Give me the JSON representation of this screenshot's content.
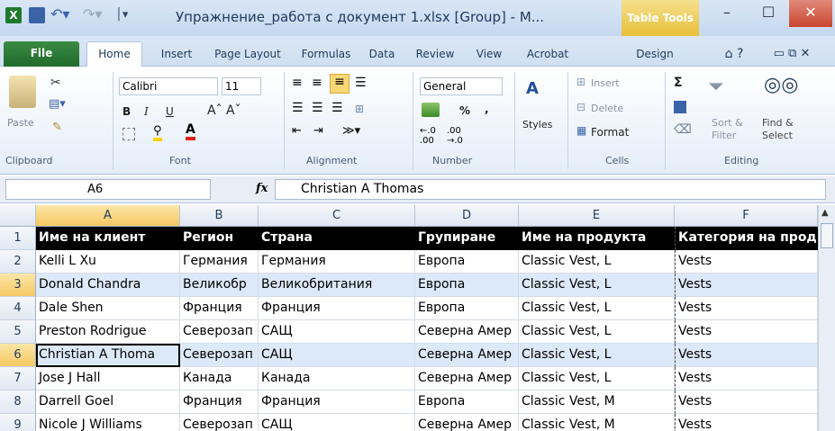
{
  "window": {
    "title": "Упражнение_работа с документ 1.xlsx  [Group]  -  M...",
    "context_tab": "Table Tools",
    "minimize": "–",
    "maximize": "☐",
    "close": "✕"
  },
  "tabs": [
    "File",
    "Home",
    "Insert",
    "Page Layout",
    "Formulas",
    "Data",
    "Review",
    "View",
    "Acrobat",
    "Design"
  ],
  "ribbon": {
    "clipboard": {
      "paste": "Paste",
      "label": "Clipboard"
    },
    "font": {
      "name": "Calibri",
      "size": "11",
      "bold": "B",
      "italic": "I",
      "underline": "U",
      "label": "Font"
    },
    "alignment": {
      "label": "Alignment"
    },
    "number": {
      "format": "General",
      "percent": "%",
      "comma": ",",
      "label": "Number"
    },
    "styles": {
      "label": "Styles"
    },
    "cells": {
      "insert": "Insert",
      "delete": "Delete",
      "format": "Format",
      "label": "Cells"
    },
    "editing": {
      "sum": "Σ",
      "sort": "Sort &",
      "filter": "Filter",
      "find": "Find &",
      "select": "Select",
      "label": "Editing"
    }
  },
  "formula_bar": {
    "name_box": "A6",
    "fx": "fx",
    "value": "Christian A Thomas"
  },
  "grid": {
    "columns": [
      "A",
      "B",
      "C",
      "D",
      "E",
      "F"
    ],
    "row_numbers": [
      "1",
      "2",
      "3",
      "4",
      "5",
      "6",
      "7",
      "8",
      "9"
    ],
    "rows": [
      [
        "Име на клиент",
        "Регион",
        "Страна",
        "Групиране",
        "Име на продукта",
        "Категория на прод"
      ],
      [
        "Kelli L Xu",
        "Германия",
        "Германия",
        "Европа",
        "Classic Vest, L",
        "Vests"
      ],
      [
        "Donald  Chandra",
        "Великобр",
        "Великобритания",
        "Европа",
        "Classic Vest, L",
        "Vests"
      ],
      [
        "Dale  Shen",
        "Франция",
        "Франция",
        "Европа",
        "Classic Vest, L",
        "Vests"
      ],
      [
        "Preston  Rodrigue",
        "Северозап",
        "САЩ",
        "Северна Амер",
        "Classic Vest, L",
        "Vests"
      ],
      [
        "Christian A Thoma",
        "Северозап",
        "САЩ",
        "Северна Амер",
        "Classic Vest, L",
        "Vests"
      ],
      [
        "Jose J Hall",
        "Канада",
        "Канада",
        "Северна Амер",
        "Classic Vest, L",
        "Vests"
      ],
      [
        "Darrell  Goel",
        "Франция",
        "Франция",
        "Европа",
        "Classic Vest, M",
        "Vests"
      ],
      [
        "Nicole J Williams",
        "Северозап",
        "САЩ",
        "Северна Амер",
        "Classic Vest, M",
        "Vests"
      ]
    ]
  },
  "colors": {
    "header_row": "#000000",
    "band_row": "#dce9f8",
    "active_header": "#f5c864"
  }
}
